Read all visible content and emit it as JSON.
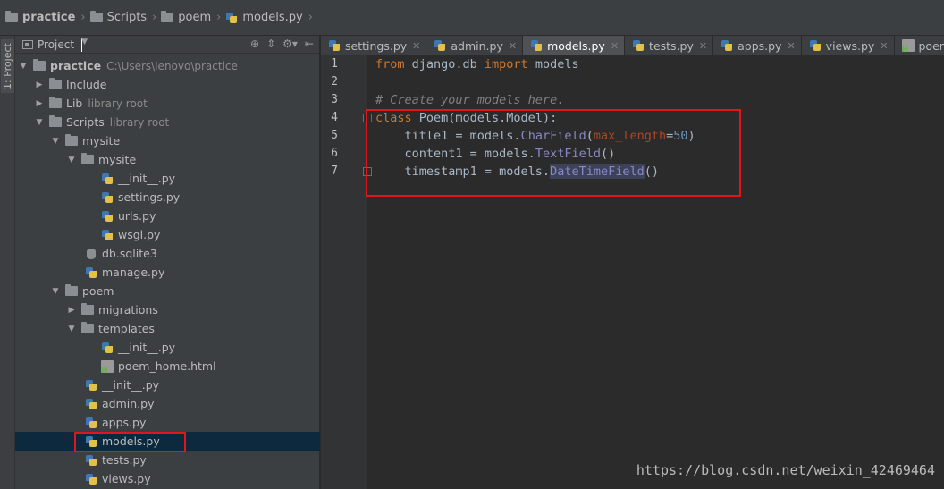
{
  "breadcrumb": {
    "items": [
      {
        "label": "practice",
        "icon": "folder-icon"
      },
      {
        "label": "Scripts",
        "icon": "folder-icon"
      },
      {
        "label": "poem",
        "icon": "folder-icon"
      },
      {
        "label": "models.py",
        "icon": "python-file-icon"
      }
    ]
  },
  "tool_strip": {
    "label": "1: Project"
  },
  "project_panel": {
    "title": "Project",
    "tree": [
      {
        "label": "practice",
        "hint": "C:\\Users\\lenovo\\practice"
      },
      {
        "label": "Include"
      },
      {
        "label": "Lib",
        "hint": "library root"
      },
      {
        "label": "Scripts",
        "hint": "library root"
      },
      {
        "label": "mysite"
      },
      {
        "label": "mysite"
      },
      {
        "label": "__init__.py"
      },
      {
        "label": "settings.py"
      },
      {
        "label": "urls.py"
      },
      {
        "label": "wsgi.py"
      },
      {
        "label": "db.sqlite3"
      },
      {
        "label": "manage.py"
      },
      {
        "label": "poem"
      },
      {
        "label": "migrations"
      },
      {
        "label": "templates"
      },
      {
        "label": "__init__.py"
      },
      {
        "label": "poem_home.html"
      },
      {
        "label": "__init__.py"
      },
      {
        "label": "admin.py"
      },
      {
        "label": "apps.py"
      },
      {
        "label": "models.py"
      },
      {
        "label": "tests.py"
      },
      {
        "label": "views.py"
      }
    ]
  },
  "tabs": [
    {
      "label": "settings.py"
    },
    {
      "label": "admin.py"
    },
    {
      "label": "models.py"
    },
    {
      "label": "tests.py"
    },
    {
      "label": "apps.py"
    },
    {
      "label": "views.py"
    },
    {
      "label": "poem_hor"
    }
  ],
  "editor": {
    "line_numbers": [
      "1",
      "2",
      "3",
      "4",
      "5",
      "6",
      "7"
    ],
    "code": {
      "l1": {
        "kw1": "from",
        "t1": " django.db ",
        "kw2": "import",
        "t2": " models"
      },
      "l3": {
        "comment": "# Create your models here."
      },
      "l4": {
        "kw": "class",
        "name": " Poem",
        "rest": "(models.Model):"
      },
      "l5": {
        "t1": "    title1 = models.",
        "fn": "CharField",
        "t2": "(",
        "param": "max_length",
        "t3": "=",
        "num": "50",
        "t4": ")"
      },
      "l6": {
        "t1": "    content1 = models.",
        "fn": "TextField",
        "t2": "()"
      },
      "l7": {
        "t1": "    timestamp1 = models.",
        "fn_a": "DateTimeFie",
        "fn_b": "ld",
        "t2": "()"
      }
    }
  },
  "watermark": "https://blog.csdn.net/weixin_42469464",
  "colors": {
    "highlight": "#e0161c",
    "selection": "#0d293e",
    "editor_bg": "#2b2b2b"
  }
}
